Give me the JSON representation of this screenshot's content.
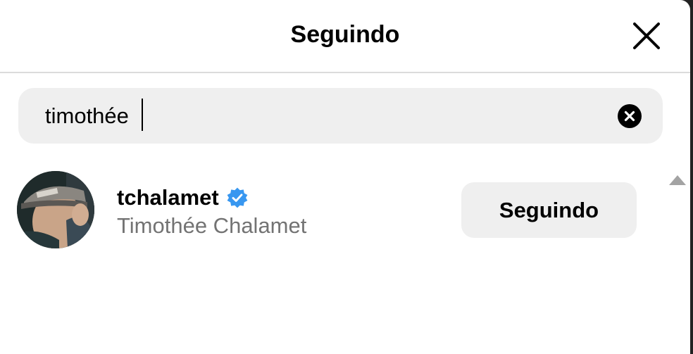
{
  "modal": {
    "title": "Seguindo",
    "close_icon": "close-icon"
  },
  "search": {
    "value": "timothée",
    "clear_icon": "clear-circle-icon"
  },
  "results": [
    {
      "username": "tchalamet",
      "verified": true,
      "full_name": "Timothée Chalamet",
      "button_label": "Seguindo"
    }
  ],
  "colors": {
    "verified_badge": "#3897f0",
    "secondary_text": "#737373",
    "button_bg": "#efefef",
    "input_bg": "#efefef"
  }
}
